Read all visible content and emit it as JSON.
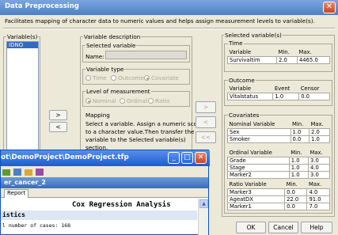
{
  "dialog": {
    "title": "Data Preprocessing",
    "close": "✕",
    "description": "Facilitates mapping of character data to numeric values and helps assign measurement levels to variable(s).",
    "variables_label": "Variable(s)",
    "variables": [
      "IDNO"
    ],
    "var_desc_label": "Variable description",
    "selected_variable_label": "Selected variable",
    "name_label": "Name:",
    "name_value": "",
    "variable_type_label": "Variable type",
    "type_options": [
      "Time",
      "Outcome",
      "Covariate"
    ],
    "level_label": "Level of measurement",
    "level_options": [
      "Nominal",
      "Ordinal",
      "Ratio"
    ],
    "mapping_label": "Mapping",
    "mapping_text_1": "Select a variable. Assign a numeric score",
    "mapping_text_2": "to a character value.Then transfer the",
    "mapping_text_3": "variable to the Selected variable(s)",
    "mapping_text_4": "section.",
    "arrow_right": ">",
    "arrow_left": "<",
    "arrow_all_left": "<<",
    "selected_vars_label": "Selected variable(s)",
    "time": {
      "label": "Time",
      "headers": [
        "Variable",
        "Min.",
        "Max."
      ],
      "rows": [
        [
          "Survivaltim",
          "2.0",
          "4465.0"
        ]
      ]
    },
    "outcome": {
      "label": "Outcome",
      "headers": [
        "Variable",
        "Event",
        "Censor"
      ],
      "rows": [
        [
          "Vitalstatus",
          "1.0",
          "0.0"
        ]
      ]
    },
    "covariates_label": "Covariates",
    "nominal": {
      "headers": [
        "Nominal Variable",
        "Min.",
        "Max."
      ],
      "rows": [
        [
          "Sex",
          "1.0",
          "2.0"
        ],
        [
          "Smoker",
          "0.0",
          "1.0"
        ]
      ]
    },
    "ordinal": {
      "headers": [
        "Ordinal Variable",
        "Min.",
        "Max."
      ],
      "rows": [
        [
          "Grade",
          "1.0",
          "3.0"
        ],
        [
          "Stage",
          "1.0",
          "4.0"
        ],
        [
          "Marker2",
          "1.0",
          "3.0"
        ]
      ]
    },
    "ratio": {
      "headers": [
        "Ratio Variable",
        "Min.",
        "Max."
      ],
      "rows": [
        [
          "Marker3",
          "0.0",
          "4.0"
        ],
        [
          "AgeatDX",
          "22.0",
          "91.0"
        ],
        [
          "Marker1",
          "0.0",
          "7.0"
        ]
      ]
    },
    "ok": "OK",
    "cancel": "Cancel",
    "help": "Help"
  },
  "report_window": {
    "title": "ot\\DemoProject\\DemoProject.tfp",
    "min": "_",
    "max": "□",
    "close": "✕",
    "dataset": "er_cancer_2",
    "tab": "Report",
    "heading": "Cox Regression Analysis",
    "section": "istics",
    "line": "l number of cases: 168"
  }
}
